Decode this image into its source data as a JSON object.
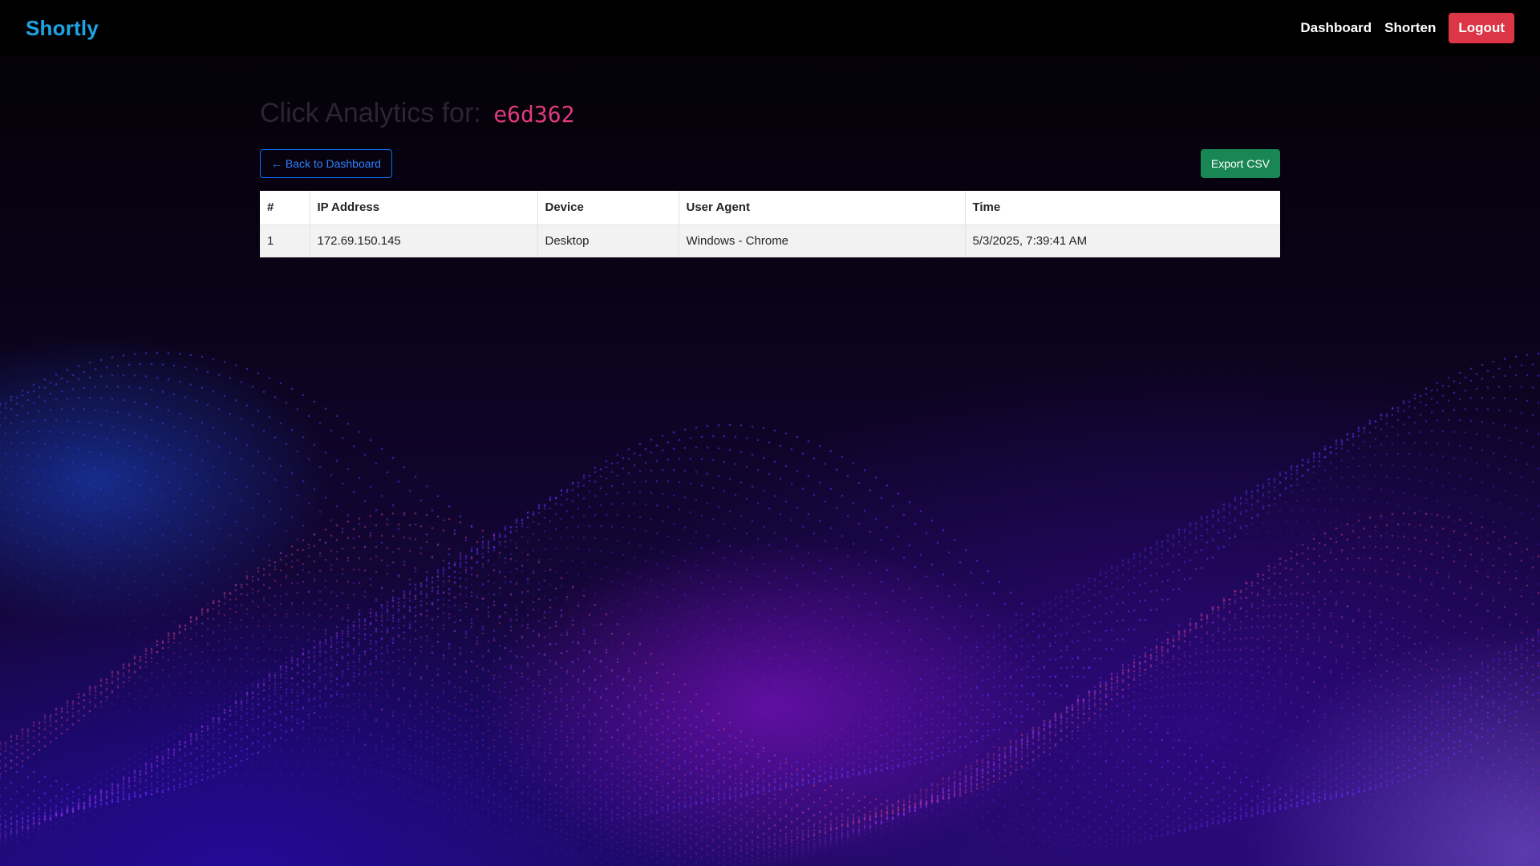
{
  "navbar": {
    "brand": "Shortly",
    "links": [
      "Dashboard",
      "Shorten"
    ],
    "logout_label": "Logout"
  },
  "page": {
    "heading_prefix": "Click Analytics for:",
    "short_code": "e6d362",
    "back_label": "← Back to Dashboard",
    "export_label": "Export CSV"
  },
  "table": {
    "headers": [
      "#",
      "IP Address",
      "Device",
      "User Agent",
      "Time"
    ],
    "rows": [
      [
        "1",
        "172.69.150.145",
        "Desktop",
        "Windows - Chrome",
        "5/3/2025, 7:39:41 AM"
      ]
    ]
  },
  "colors": {
    "brand": "#1ea4e6",
    "logout": "#dc3545",
    "export": "#198754",
    "back_outline": "#0d6efd",
    "short_code": "#e03a7a"
  },
  "icons": {
    "background": "particle-wave-background"
  }
}
